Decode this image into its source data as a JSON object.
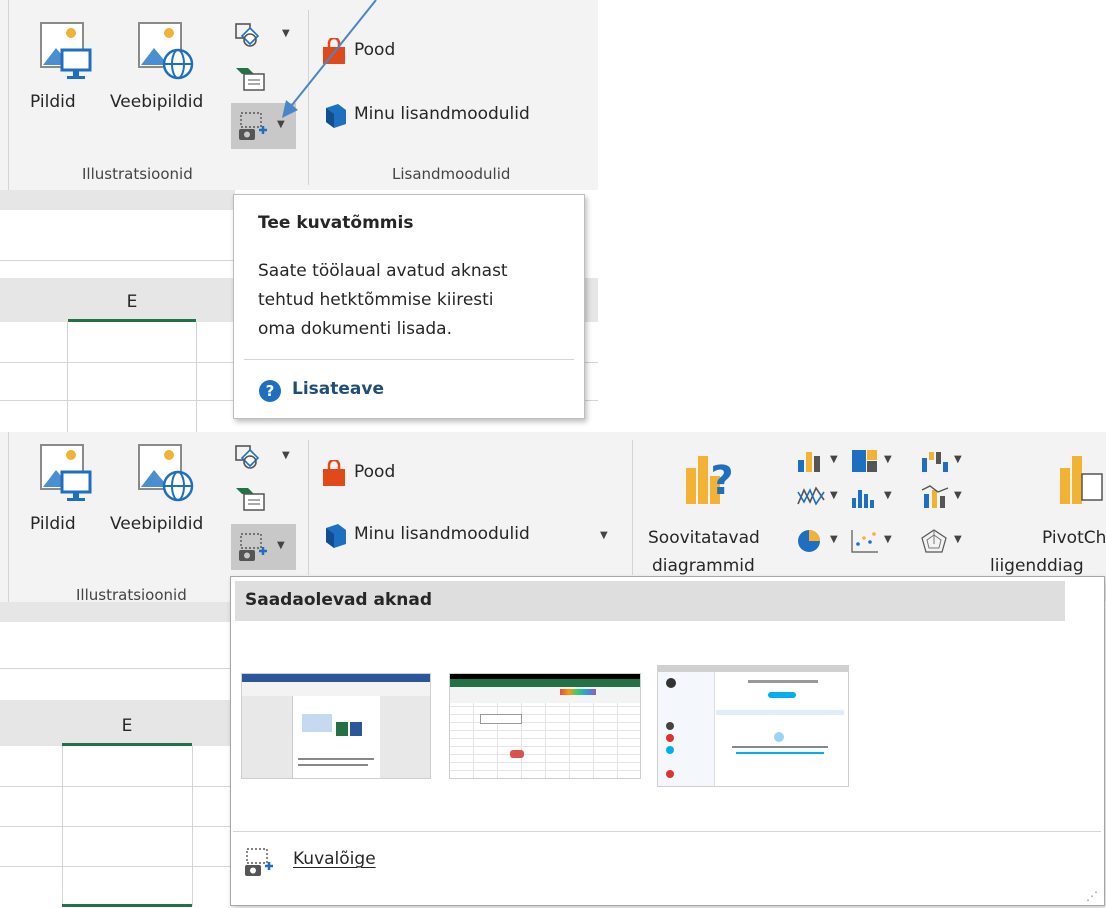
{
  "top": {
    "buttons": {
      "pildid": "Pildid",
      "veebipildid": "Veebipildid",
      "pood": "Pood",
      "minu_lisandmoodulid": "Minu lisandmoodulid"
    },
    "groups": {
      "illustratsioonid": "Illustratsioonid",
      "lisandmoodulid": "Lisandmoodulid"
    },
    "column_header": "E",
    "tooltip": {
      "title": "Tee kuvatõmmis",
      "body_lines": [
        "Saate töölaual avatud aknast",
        "tehtud hetktõmmise kiiresti",
        "oma dokumenti lisada."
      ],
      "link": "Lisateave"
    }
  },
  "bottom": {
    "buttons": {
      "pildid": "Pildid",
      "veebipildid": "Veebipildid",
      "pood": "Pood",
      "minu_lisandmoodulid": "Minu lisandmoodulid",
      "soovitatavad_1": "Soovitatavad",
      "soovitatavad_2": "diagrammid",
      "pivot_1": "PivotCh",
      "pivot_2": "liigenddiag"
    },
    "groups": {
      "illustratsioonid": "Illustratsioonid"
    },
    "column_header": "E",
    "dropdown": {
      "header": "Saadaolevad aknad",
      "windows": [
        "Word window",
        "Excel window",
        "Skype window"
      ],
      "screen_clipping": "Kuvalõige"
    }
  },
  "colors": {
    "accent_green": "#217346",
    "link_blue": "#1f4e79",
    "arrow_blue": "#4a86c5",
    "office_orange": "#d83b01"
  }
}
